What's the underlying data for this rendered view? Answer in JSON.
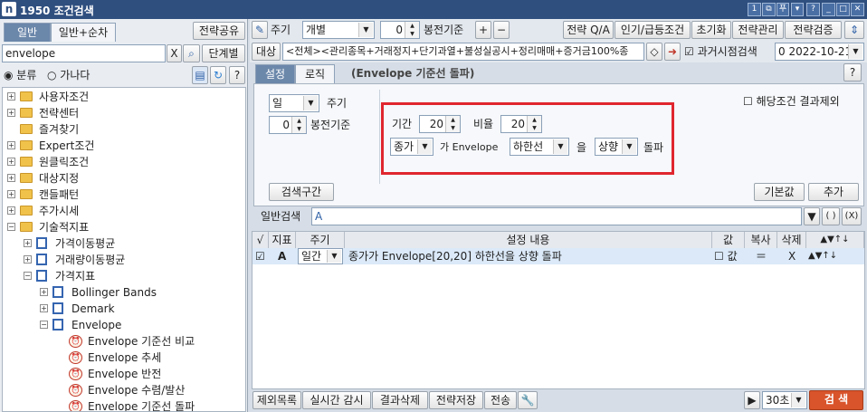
{
  "window": {
    "number": "1950",
    "title": "조건검색"
  },
  "titlebar_buttons": [
    "1",
    "⧉",
    "푸",
    "▾",
    "?",
    "_",
    "□",
    "✕"
  ],
  "left": {
    "tabs": [
      "일반",
      "일반+순차"
    ],
    "share_button": "전략공유",
    "search_value": "envelope",
    "clear_button": "X",
    "step_button": "단계별",
    "sort_options": [
      "분류",
      "가나다"
    ],
    "help": "?",
    "tree": [
      {
        "label": "사용자조건",
        "type": "folder",
        "level": 0,
        "exp": "+"
      },
      {
        "label": "전략센터",
        "type": "folder",
        "level": 0,
        "exp": "+"
      },
      {
        "label": "즐겨찾기",
        "type": "folder",
        "level": 0,
        "exp": ""
      },
      {
        "label": "Expert조건",
        "type": "folder",
        "level": 0,
        "exp": "+"
      },
      {
        "label": "원클릭조건",
        "type": "folder",
        "level": 0,
        "exp": "+"
      },
      {
        "label": "대상지정",
        "type": "folder",
        "level": 0,
        "exp": "+"
      },
      {
        "label": "캔들패턴",
        "type": "folder",
        "level": 0,
        "exp": "+"
      },
      {
        "label": "주가시세",
        "type": "folder",
        "level": 0,
        "exp": "+"
      },
      {
        "label": "기술적지표",
        "type": "folder",
        "level": 0,
        "exp": "-"
      },
      {
        "label": "가격이동평균",
        "type": "doc",
        "level": 1,
        "exp": "+"
      },
      {
        "label": "거래량이동평균",
        "type": "doc",
        "level": 1,
        "exp": "+"
      },
      {
        "label": "가격지표",
        "type": "doc",
        "level": 1,
        "exp": "-"
      },
      {
        "label": "Bollinger Bands",
        "type": "doc",
        "level": 2,
        "exp": "+"
      },
      {
        "label": "Demark",
        "type": "doc",
        "level": 2,
        "exp": "+"
      },
      {
        "label": "Envelope",
        "type": "doc",
        "level": 2,
        "exp": "-"
      },
      {
        "label": "Envelope 기준선 비교",
        "type": "alarm",
        "level": 3,
        "exp": ""
      },
      {
        "label": "Envelope 추세",
        "type": "alarm",
        "level": 3,
        "exp": ""
      },
      {
        "label": "Envelope 반전",
        "type": "alarm",
        "level": 3,
        "exp": ""
      },
      {
        "label": "Envelope 수렴/발산",
        "type": "alarm",
        "level": 3,
        "exp": ""
      },
      {
        "label": "Envelope 기준선 돌파",
        "type": "alarm",
        "level": 3,
        "exp": ""
      }
    ]
  },
  "toolbar": {
    "period_label": "주기",
    "period_value": "개별",
    "bong_value": "0",
    "bong_label": "봉전기준",
    "plus": "+",
    "minus": "−",
    "strategy_qa": "전략 Q/A",
    "popular": "인기/급등조건",
    "reset": "초기화",
    "manage": "전략관리",
    "verify": "전략검증",
    "target_label": "대상",
    "target_value": "<전체><관리종목+거래정지+단기과열+불성실공시+정리매매+증거금100%종",
    "past_label": "과거시점검색",
    "past_value": "0  2022-10-21"
  },
  "tabs": {
    "settings": "설정",
    "logic": "로직",
    "caption": "(Envelope 기준선 돌파)",
    "help": "?"
  },
  "settings": {
    "period_value": "일",
    "period_label": "주기",
    "bong_value": "0",
    "bong_label": "봉전기준",
    "exclude_label": "해당조건 결과제외",
    "period2_label": "기간",
    "period2_value": "20",
    "ratio_label": "비율",
    "ratio_value": "20",
    "price_value": "종가",
    "ga_envelope": "가 Envelope",
    "line_value": "하한선",
    "eul": "을",
    "dir_value": "상향",
    "breakout": "돌파",
    "search_range": "검색구간",
    "default_btn": "기본값",
    "add_btn": "추가",
    "general_label": "일반검색",
    "general_value": "A",
    "paren": "( )",
    "neg_paren": "(X)"
  },
  "grid": {
    "headers": [
      "√",
      "지표",
      "주기",
      "설정 내용",
      "값",
      "복사",
      "삭제"
    ],
    "row": {
      "letter": "A",
      "period": "일간",
      "content": "종가가 Envelope[20,20] 하한선을 상향 돌파",
      "value": "값",
      "copy": "＝",
      "delete": "X"
    }
  },
  "bottom": {
    "exclude_list": "제외목록",
    "realtime": "실시간 감시",
    "delete_results": "결과삭제",
    "save": "전략저장",
    "send": "전송",
    "interval": "30초",
    "search": "검 색"
  },
  "colors": {
    "highlight_box": "#e0262e",
    "search_button": "#d9542b",
    "title_bg": "#2f4f7f",
    "selected_row": "#dbe9f8"
  }
}
